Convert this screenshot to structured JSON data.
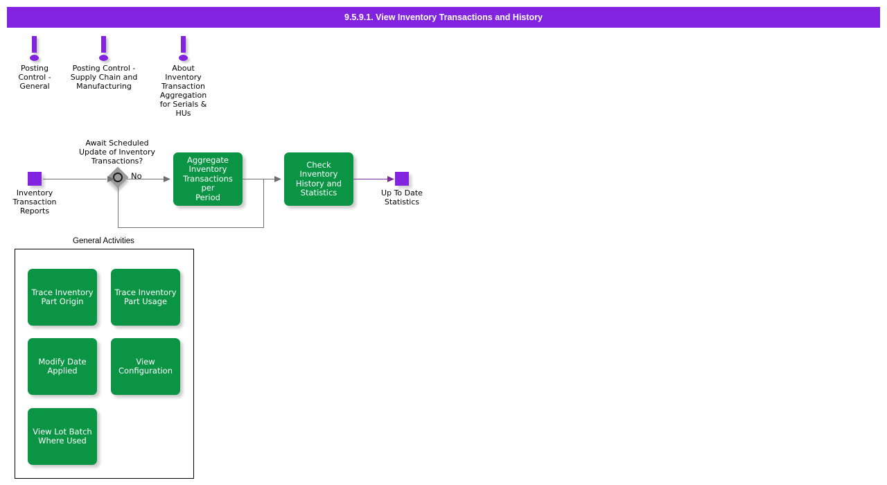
{
  "header": {
    "title": "9.5.9.1. View Inventory Transactions and History",
    "bar_color": "#8223e0",
    "text_color": "#ffffff"
  },
  "notes": [
    {
      "icon": "exclamation-icon",
      "label": "Posting\nControl -\nGeneral"
    },
    {
      "icon": "exclamation-icon",
      "label": "Posting Control -\nSupply Chain and\nManufacturing"
    },
    {
      "icon": "exclamation-icon",
      "label": "About\nInventory\nTransaction\nAggregation\nfor Serials &\nHUs"
    }
  ],
  "flow": {
    "start": {
      "node_name": "inventory-transaction-reports",
      "label": "Inventory\nTransaction\nReports",
      "color": "#8223e0"
    },
    "decision": {
      "question": "Await Scheduled\nUpdate of Inventory\nTransactions?",
      "branch_label": "No",
      "color": "#9a9a9a"
    },
    "activities": [
      {
        "node_name": "aggregate-inventory-transactions-per-period",
        "label": "Aggregate\nInventory\nTransactions per\nPeriod",
        "color": "#0b9444"
      },
      {
        "node_name": "check-inventory-history-and-statistics",
        "label": "Check Inventory\nHistory and\nStatistics",
        "color": "#0b9444"
      }
    ],
    "end": {
      "node_name": "up-to-date-statistics",
      "label": "Up To Date\nStatistics",
      "color": "#8223e0"
    },
    "connector_color": "#6e6e6e",
    "final_connector_color": "#7d2a9e"
  },
  "general_activities": {
    "title": "General Activities",
    "items": [
      {
        "label": "Trace Inventory\nPart Origin",
        "color": "#0b9444"
      },
      {
        "label": "Trace Inventory\nPart Usage",
        "color": "#0b9444"
      },
      {
        "label": "Modify Date\nApplied",
        "color": "#0b9444"
      },
      {
        "label": "View\nConfiguration",
        "color": "#0b9444"
      },
      {
        "label": "View Lot Batch\nWhere Used",
        "color": "#0b9444"
      }
    ]
  }
}
